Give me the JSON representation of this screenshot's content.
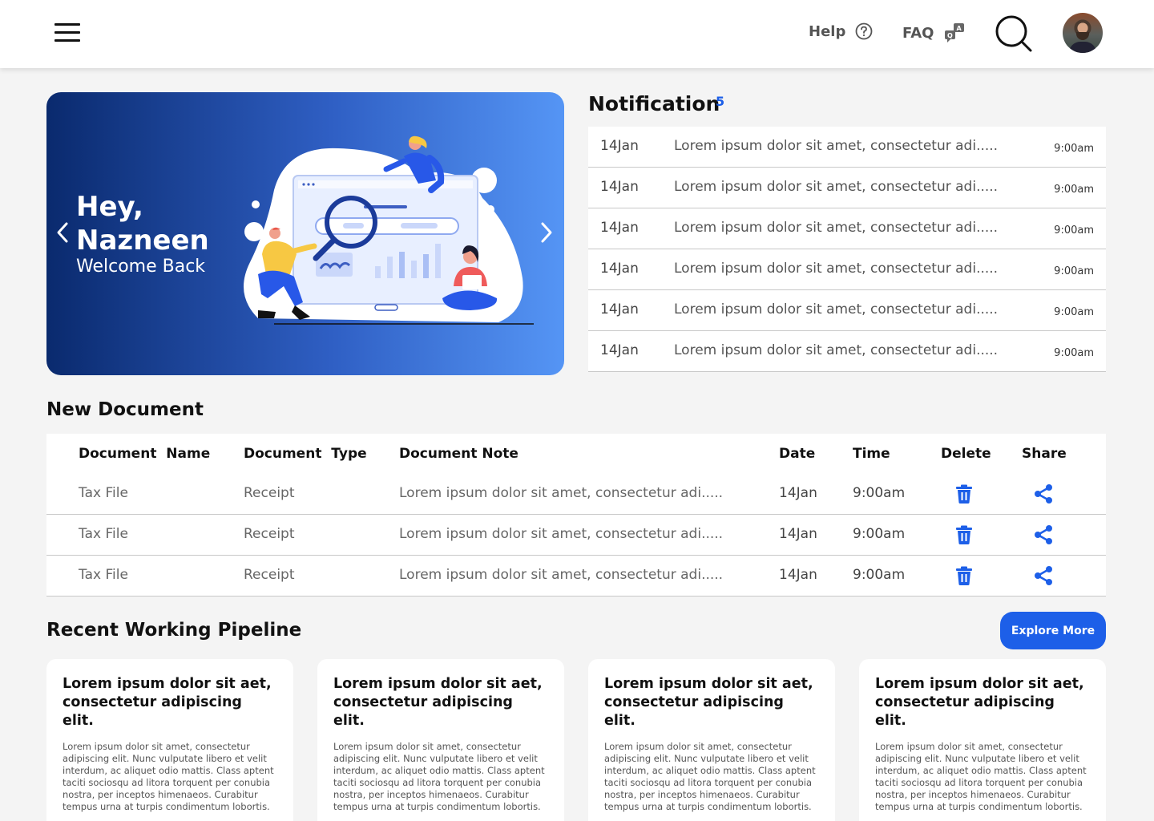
{
  "header": {
    "help_label": "Help",
    "faq_label": "FAQ"
  },
  "hero": {
    "greeting": "Hey,",
    "name": "Nazneen",
    "welcome": "Welcome Back"
  },
  "notifications": {
    "title": "Notification",
    "count": "5",
    "items": [
      {
        "date": "14Jan",
        "text": "Lorem ipsum dolor sit amet, consectetur adi.....",
        "time": "9:00am"
      },
      {
        "date": "14Jan",
        "text": "Lorem ipsum dolor sit amet, consectetur adi.....",
        "time": "9:00am"
      },
      {
        "date": "14Jan",
        "text": "Lorem ipsum dolor sit amet, consectetur adi.....",
        "time": "9:00am"
      },
      {
        "date": "14Jan",
        "text": "Lorem ipsum dolor sit amet, consectetur adi.....",
        "time": "9:00am"
      },
      {
        "date": "14Jan",
        "text": "Lorem ipsum dolor sit amet, consectetur adi.....",
        "time": "9:00am"
      },
      {
        "date": "14Jan",
        "text": "Lorem ipsum dolor sit amet, consectetur adi.....",
        "time": "9:00am"
      }
    ]
  },
  "documents": {
    "title": "New Document",
    "columns": {
      "name": "Document  Name",
      "type": "Document  Type",
      "note": "Document Note",
      "date": "Date",
      "time": "Time",
      "delete": "Delete",
      "share": "Share"
    },
    "rows": [
      {
        "name": "Tax File",
        "type": "Receipt",
        "note": "Lorem ipsum dolor sit amet, consectetur adi.....",
        "date": "14Jan",
        "time": "9:00am"
      },
      {
        "name": "Tax File",
        "type": "Receipt",
        "note": "Lorem ipsum dolor sit amet, consectetur adi.....",
        "date": "14Jan",
        "time": "9:00am"
      },
      {
        "name": "Tax File",
        "type": "Receipt",
        "note": "Lorem ipsum dolor sit amet, consectetur adi.....",
        "date": "14Jan",
        "time": "9:00am"
      }
    ]
  },
  "pipeline": {
    "title": "Recent Working Pipeline",
    "explore_label": "Explore More",
    "cards": [
      {
        "heading": "Lorem ipsum dolor sit aet, consectetur adipiscing elit.",
        "body": "Lorem ipsum dolor sit amet, consectetur adipiscing elit. Nunc vulputate libero et velit interdum, ac aliquet odio mattis. Class aptent taciti sociosqu ad litora torquent per conubia nostra, per inceptos himenaeos. Curabitur tempus urna at turpis condimentum lobortis."
      },
      {
        "heading": "Lorem ipsum dolor sit aet, consectetur adipiscing elit.",
        "body": "Lorem ipsum dolor sit amet, consectetur adipiscing elit. Nunc vulputate libero et velit interdum, ac aliquet odio mattis. Class aptent taciti sociosqu ad litora torquent per conubia nostra, per inceptos himenaeos. Curabitur tempus urna at turpis condimentum lobortis."
      },
      {
        "heading": "Lorem ipsum dolor sit aet, consectetur adipiscing elit.",
        "body": "Lorem ipsum dolor sit amet, consectetur adipiscing elit. Nunc vulputate libero et velit interdum, ac aliquet odio mattis. Class aptent taciti sociosqu ad litora torquent per conubia nostra, per inceptos himenaeos. Curabitur tempus urna at turpis condimentum lobortis."
      },
      {
        "heading": "Lorem ipsum dolor sit aet, consectetur adipiscing elit.",
        "body": "Lorem ipsum dolor sit amet, consectetur adipiscing elit. Nunc vulputate libero et velit interdum, ac aliquet odio mattis. Class aptent taciti sociosqu ad litora torquent per conubia nostra, per inceptos himenaeos. Curabitur tempus urna at turpis condimentum lobortis."
      }
    ]
  },
  "colors": {
    "accent": "#1d5fe8",
    "hero_start": "#0a2a6e",
    "hero_end": "#5595f5"
  }
}
